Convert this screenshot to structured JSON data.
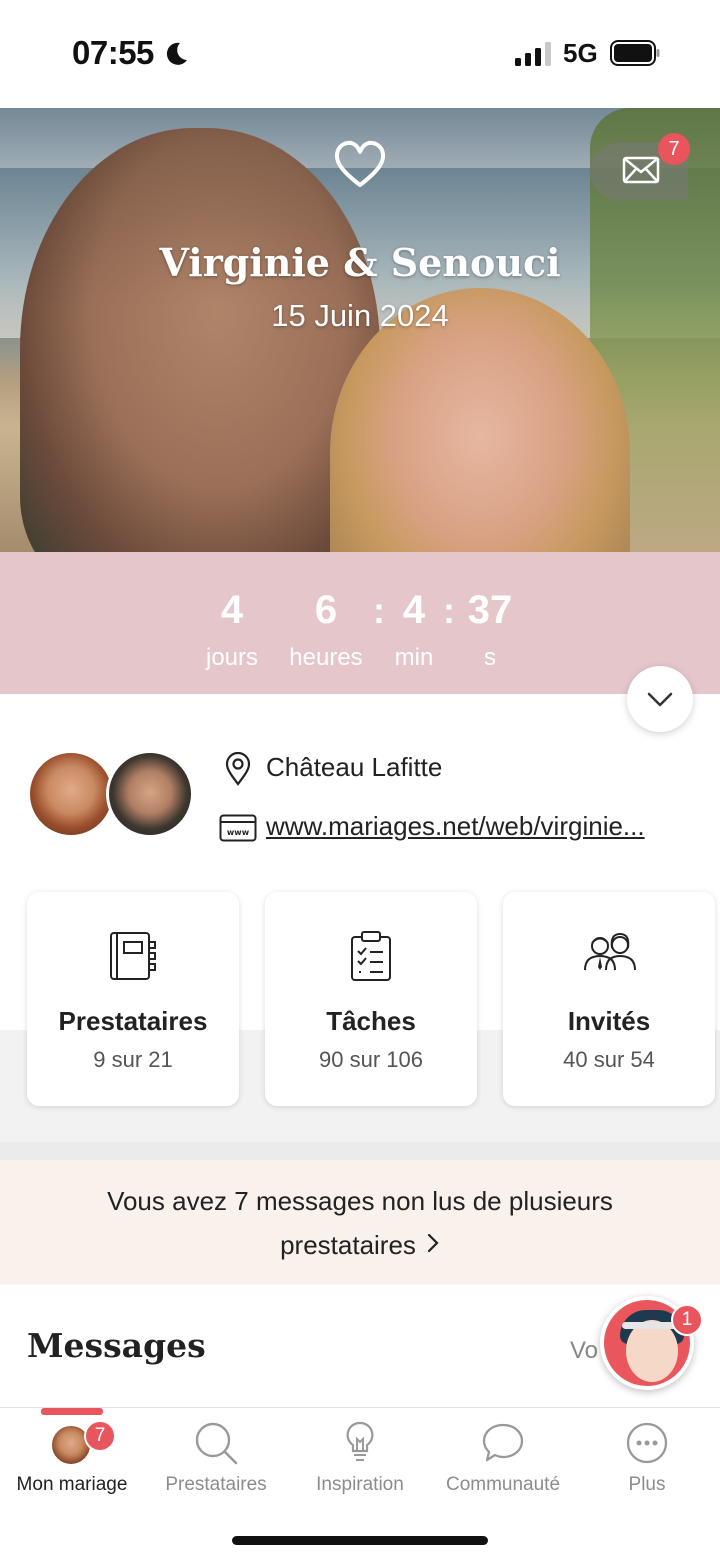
{
  "status_bar": {
    "time": "07:55",
    "network": "5G"
  },
  "hero": {
    "couple_names": "Virginie & Senouci",
    "wedding_date": "15 Juin 2024",
    "mail_badge": "7"
  },
  "countdown": {
    "days": "4",
    "days_label": "jours",
    "hours": "6",
    "hours_label": "heures",
    "minutes": "4",
    "minutes_label": "min",
    "seconds": "37",
    "seconds_label": "s",
    "separator": ":"
  },
  "info": {
    "venue": "Château Lafitte",
    "website": "www.mariages.net/web/virginie..."
  },
  "cards": [
    {
      "title": "Prestataires",
      "subtitle": "9 sur 21",
      "icon": "notebook-icon"
    },
    {
      "title": "Tâches",
      "subtitle": "90 sur 106",
      "icon": "clipboard-checklist-icon"
    },
    {
      "title": "Invités",
      "subtitle": "40 sur 54",
      "icon": "guests-icon"
    }
  ],
  "banner": {
    "line1": "Vous avez 7 messages non lus de plusieurs",
    "line2": "prestataires"
  },
  "messages": {
    "title": "Messages",
    "see_all": "Vo"
  },
  "assistant": {
    "badge": "1"
  },
  "tabbar": {
    "items": [
      {
        "label": "Mon mariage",
        "badge": "7",
        "active": true
      },
      {
        "label": "Prestataires"
      },
      {
        "label": "Inspiration"
      },
      {
        "label": "Communauté"
      },
      {
        "label": "Plus"
      }
    ]
  },
  "colors": {
    "accent": "#e8555c",
    "countdown_bg": "#e5c7cb",
    "banner_bg": "#f8f1ec"
  }
}
